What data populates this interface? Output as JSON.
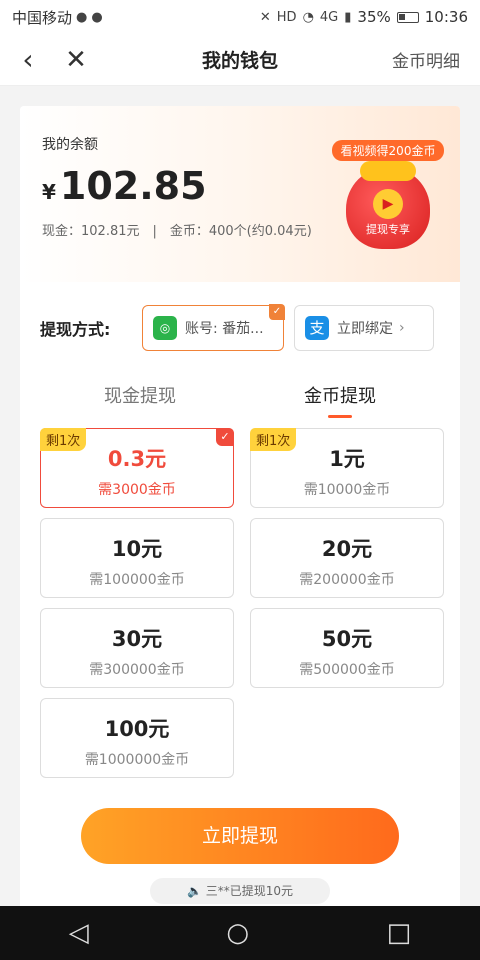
{
  "statusbar": {
    "carrier": "中国移动",
    "network": "4G",
    "battery": "35%",
    "time": "10:36"
  },
  "header": {
    "title": "我的钱包",
    "detail_link": "金币明细"
  },
  "balance": {
    "label": "我的余额",
    "currency": "¥",
    "amount": "102.85",
    "breakdown": "现金：102.81元　|　金币：400个(约0.04元)",
    "promo_tag": "看视频得200金币",
    "promo_bag_text": "提现专享"
  },
  "withdraw_method": {
    "label": "提现方式:",
    "wechat_account": "账号: 番茄...",
    "alipay_action": "立即绑定"
  },
  "tabs": [
    {
      "label": "现金提现"
    },
    {
      "label": "金币提现"
    }
  ],
  "options": [
    {
      "value": "0.3元",
      "need": "需3000金币",
      "badge": "剩1次"
    },
    {
      "value": "1元",
      "need": "需10000金币",
      "badge": "剩1次"
    },
    {
      "value": "10元",
      "need": "需100000金币"
    },
    {
      "value": "20元",
      "need": "需200000金币"
    },
    {
      "value": "30元",
      "need": "需300000金币"
    },
    {
      "value": "50元",
      "need": "需500000金币"
    },
    {
      "value": "100元",
      "need": "需1000000金币"
    }
  ],
  "submit_label": "立即提现",
  "notice": "三**已提现10元"
}
